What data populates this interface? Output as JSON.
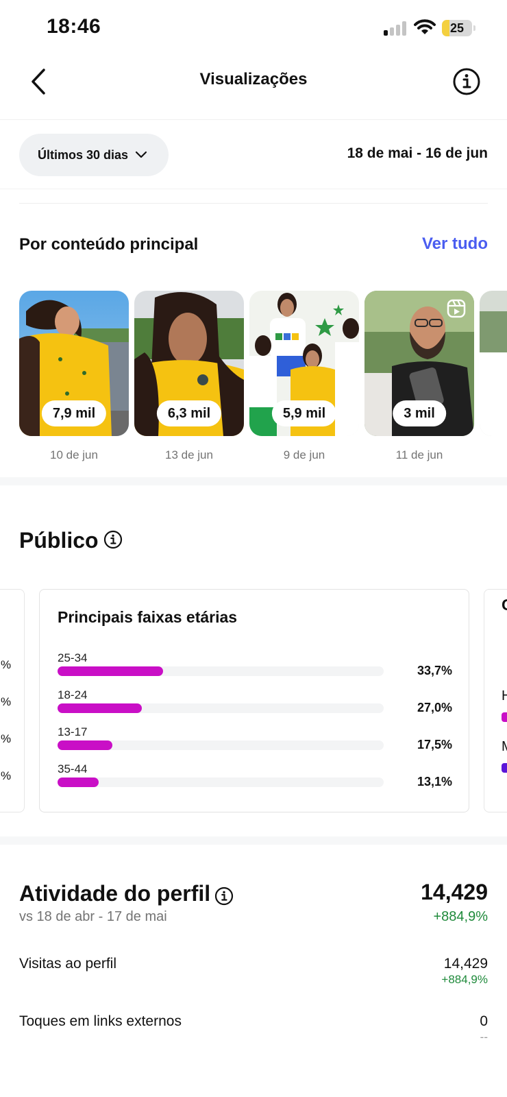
{
  "status": {
    "time": "18:46",
    "battery": "25",
    "battery_level": 0.25
  },
  "header": {
    "title": "Visualizações"
  },
  "filter": {
    "period_label": "Últimos 30 dias",
    "date_range": "18 de mai - 16 de jun"
  },
  "top_content": {
    "title": "Por conteúdo principal",
    "see_all": "Ver tudo",
    "items": [
      {
        "views": "7,9 mil",
        "date": "10 de jun"
      },
      {
        "views": "6,3 mil",
        "date": "13 de jun"
      },
      {
        "views": "5,9 mil",
        "date": "9 de jun"
      },
      {
        "views": "3 mil",
        "date": "11 de jun"
      }
    ]
  },
  "audience": {
    "title": "Público",
    "age_card": {
      "title": "Principais faixas etárias",
      "rows": [
        {
          "label": "25-34",
          "pct": "33,7%",
          "value": 33.7
        },
        {
          "label": "18-24",
          "pct": "27,0%",
          "value": 27.0
        },
        {
          "label": "13-17",
          "pct": "17,5%",
          "value": 17.5
        },
        {
          "label": "35-44",
          "pct": "13,1%",
          "value": 13.1
        }
      ]
    },
    "left_card_values": [
      "%",
      "%",
      "%",
      "%"
    ],
    "right_card": {
      "title_fragment": "G",
      "letters": [
        "H",
        "M"
      ]
    }
  },
  "activity": {
    "title": "Atividade do perfil",
    "comparison": "vs 18 de abr - 17 de mai",
    "total": "14,429",
    "total_change": "+884,9%",
    "metrics": [
      {
        "label": "Visitas ao perfil",
        "value": "14,429",
        "change": "+884,9%"
      },
      {
        "label": "Toques em links externos",
        "value": "0",
        "change": "--"
      }
    ]
  },
  "colors": {
    "accent": "#4a5df0",
    "bar": "#c90fc6",
    "positive": "#1f8a3b"
  }
}
